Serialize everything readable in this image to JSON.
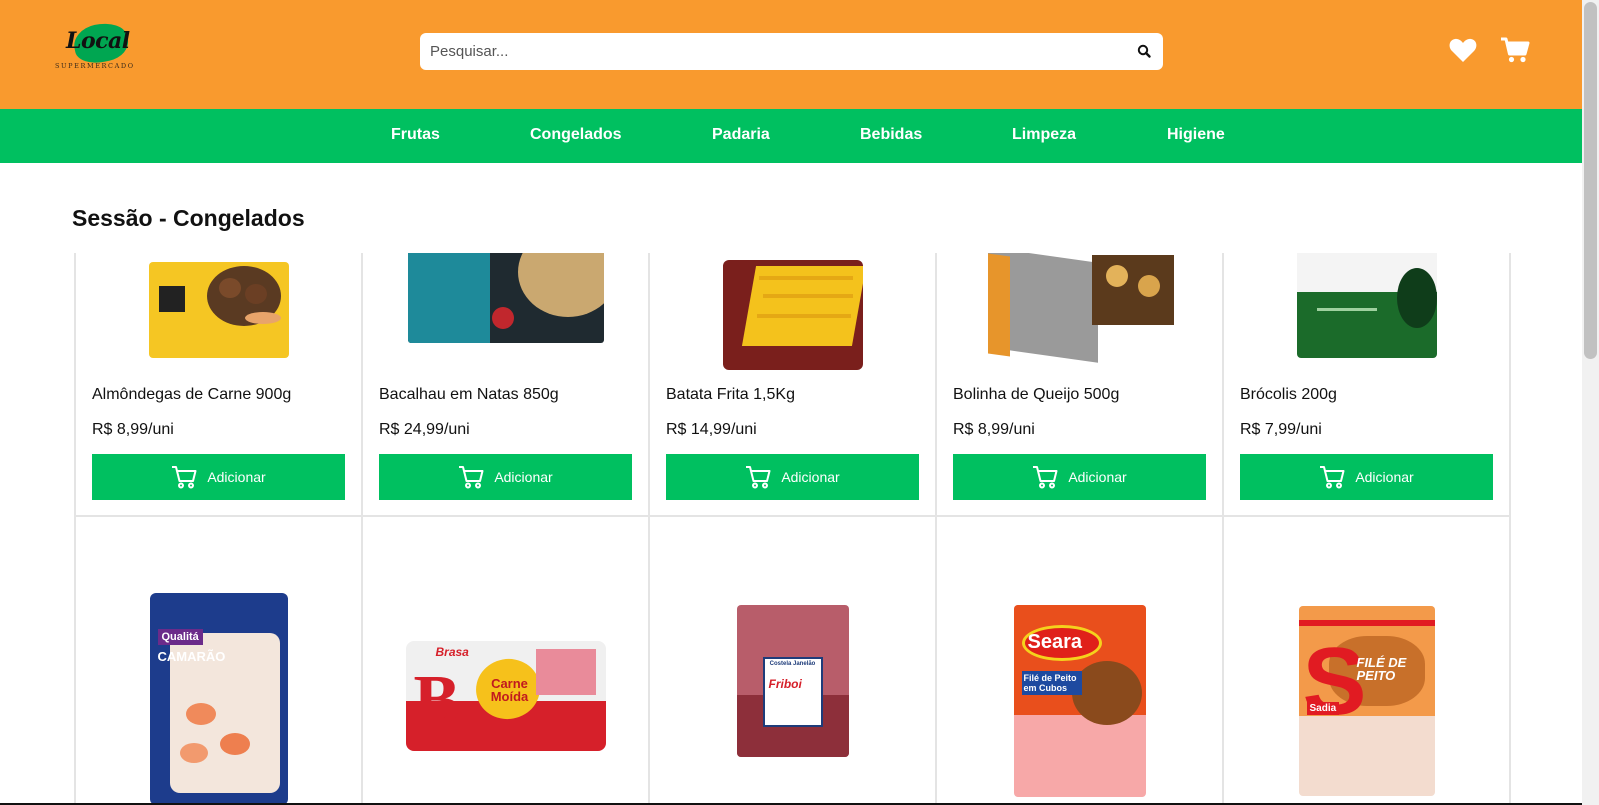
{
  "brand": {
    "name": "Local",
    "tagline": "SUPERMERCADO"
  },
  "search": {
    "placeholder": "Pesquisar...",
    "value": ""
  },
  "icons": {
    "search": "search-icon",
    "favorites": "heart-icon",
    "cart": "cart-icon"
  },
  "colors": {
    "header": "#f99a2e",
    "nav": "#00c060",
    "button": "#00c060"
  },
  "nav": {
    "items": [
      "Frutas",
      "Congelados",
      "Padaria",
      "Bebidas",
      "Limpeza",
      "Higiene"
    ]
  },
  "section": {
    "title": "Sessão - Congelados"
  },
  "products": [
    {
      "name": "Almôndegas de Carne 900g",
      "price": "R$ 8,99/uni",
      "button": "Adicionar"
    },
    {
      "name": "Bacalhau em Natas 850g",
      "price": "R$ 24,99/uni",
      "button": "Adicionar"
    },
    {
      "name": "Batata Frita 1,5Kg",
      "price": "R$ 14,99/uni",
      "button": "Adicionar"
    },
    {
      "name": "Bolinha de Queijo 500g",
      "price": "R$ 8,99/uni",
      "button": "Adicionar"
    },
    {
      "name": "Brócolis 200g",
      "price": "R$ 7,99/uni",
      "button": "Adicionar"
    }
  ],
  "product_images_row2": [
    {
      "brand": "Qualitá",
      "label": "CAMARÃO"
    },
    {
      "brand": "Brasa",
      "label": "Carne Moída"
    },
    {
      "brand": "Friboi",
      "label": "Costela Janelão"
    },
    {
      "brand": "Seara",
      "label": "Filé de Peito em Cubos"
    },
    {
      "brand": "Sadia",
      "label": "FILÉ DE PEITO"
    }
  ]
}
